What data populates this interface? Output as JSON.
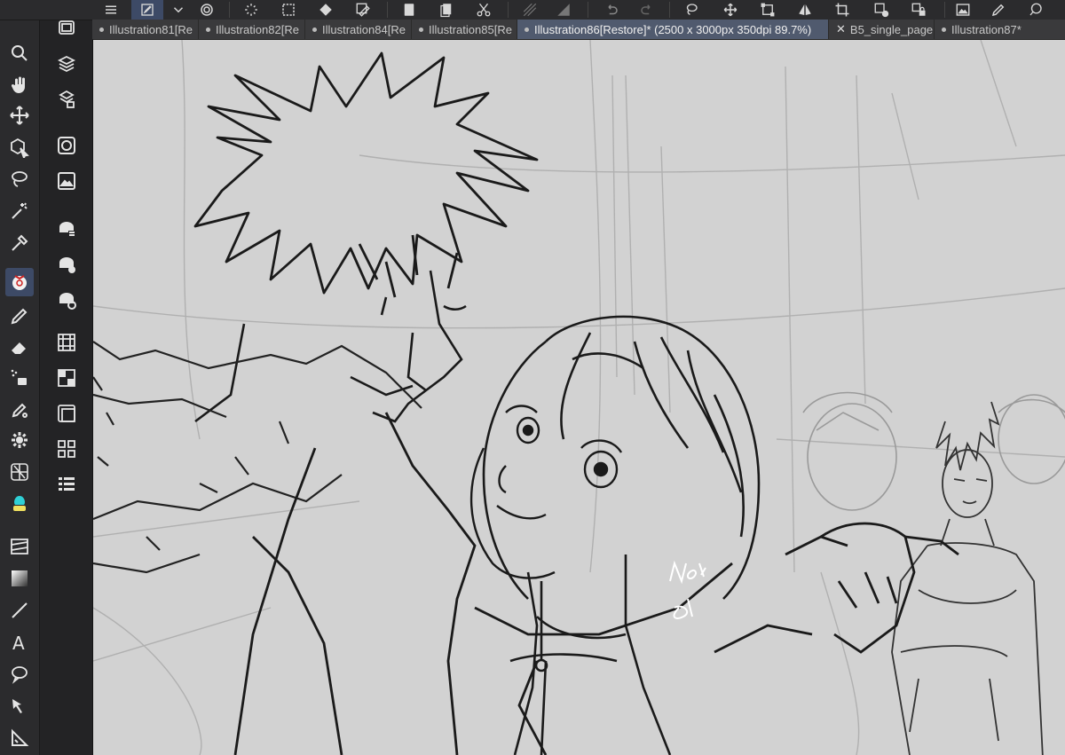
{
  "toolbar": {
    "buttons": [
      "menu-icon",
      "edit-icon",
      "chevron-down-icon",
      "spiral-icon",
      "loading-icon",
      "dashed-box-icon",
      "diamond-icon",
      "select-edit-icon",
      "page-icon",
      "pages-icon",
      "scissors-icon",
      "hatch-icon",
      "fill-icon",
      "undo-icon",
      "redo-icon",
      "lasso-icon",
      "move-icon",
      "transform-icon",
      "crop-icon",
      "flip-icon",
      "select-add-icon",
      "lock-icon",
      "image-icon",
      "pen-icon",
      "ellipsis-icon",
      "chat-icon"
    ]
  },
  "tabs": [
    {
      "label": "Illustration81[Re",
      "active": false
    },
    {
      "label": "Illustration82[Re",
      "active": false
    },
    {
      "label": "Illustration84[Re",
      "active": false
    },
    {
      "label": "Illustration85[Re",
      "active": false
    },
    {
      "label": "Illustration86[Restore]* (2500 x 3000px 350dpi 89.7%)",
      "active": true
    },
    {
      "label": "B5_single_page",
      "active": false
    },
    {
      "label": "Illustration87*",
      "active": false
    }
  ],
  "tools": [
    "zoom-icon",
    "hand-icon",
    "move-icon",
    "object-icon",
    "lasso-icon",
    "magic-wand-icon",
    "eyedropper-icon",
    "sub-tool-icon",
    "pen-icon",
    "eraser-icon",
    "airbrush-icon",
    "decoration-icon",
    "gear-icon",
    "perspective-icon",
    "blend-icon",
    "frame-icon",
    "gradient-icon",
    "line-icon",
    "text-icon",
    "balloon-icon",
    "correct-line-icon",
    "ruler-icon"
  ],
  "subtools": [
    "layer-icon",
    "layers-icon",
    "layer-property-icon",
    "circle-icon",
    "navigator-icon",
    "material-1-icon",
    "material-2-icon",
    "material-3-icon",
    "timeline-icon",
    "checker-icon",
    "frame-icon",
    "grid-icon",
    "list-icon"
  ],
  "canvas": {
    "document": "Illustration86[Restore]*",
    "size": "2500 x 3000px",
    "dpi": "350dpi",
    "zoom": "89.7%",
    "background": "#d2d2d2"
  },
  "colors": {
    "accent": "#3d4a66",
    "chrome": "#2b2b2d",
    "tab_active": "#505a6e"
  }
}
